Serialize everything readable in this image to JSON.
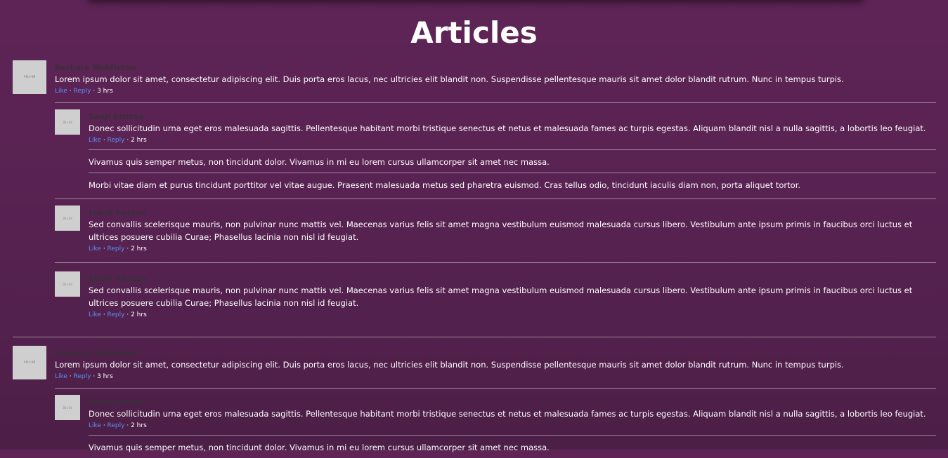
{
  "page": {
    "title": "Articles"
  },
  "threads": [
    {
      "author": "Barbara Middleton",
      "avatar_text": "48×48",
      "text": "Lorem ipsum dolor sit amet, consectetur adipiscing elit. Duis porta eros lacus, nec ultricies elit blandit non. Suspendisse pellentesque mauris sit amet dolor blandit rutrum. Nunc in tempus turpis.",
      "like": "Like",
      "reply": "Reply",
      "time": "3 hrs",
      "replies": [
        {
          "author": "Sonji Britton",
          "avatar_text": "36×36",
          "text": "Donec sollicitudin urna eget eros malesuada sagittis. Pellentesque habitant morbi tristique senectus et netus et malesuada fames ac turpis egestas. Aliquam blandit nisl a nulla sagittis, a lobortis leo feugiat.",
          "like": "Like",
          "reply": "Reply",
          "time": "2 hrs",
          "notes": [
            "Vivamus quis semper metus, non tincidunt dolor. Vivamus in mi eu lorem cursus ullamcorper sit amet nec massa.",
            "Morbi vitae diam et purus tincidunt porttitor vel vitae augue. Praesent malesuada metus sed pharetra euismod. Cras tellus odio, tincidunt iaculis diam non, porta aliquet tortor."
          ]
        },
        {
          "author": "Frank Keeton",
          "avatar_text": "36×36",
          "text": "Sed convallis scelerisque mauris, non pulvinar nunc mattis vel. Maecenas varius felis sit amet magna vestibulum euismod malesuada cursus libero. Vestibulum ante ipsum primis in faucibus orci luctus et ultrices posuere cubilia Curae; Phasellus lacinia non nisl id feugiat.",
          "like": "Like",
          "reply": "Reply",
          "time": "2 hrs"
        },
        {
          "author": "Frank Keeton",
          "avatar_text": "36×36",
          "text": "Sed convallis scelerisque mauris, non pulvinar nunc mattis vel. Maecenas varius felis sit amet magna vestibulum euismod malesuada cursus libero. Vestibulum ante ipsum primis in faucibus orci luctus et ultrices posuere cubilia Curae; Phasellus lacinia non nisl id feugiat.",
          "like": "Like",
          "reply": "Reply",
          "time": "2 hrs"
        }
      ]
    },
    {
      "author": "Barbara Middleton",
      "avatar_text": "48×48",
      "text": "Lorem ipsum dolor sit amet, consectetur adipiscing elit. Duis porta eros lacus, nec ultricies elit blandit non. Suspendisse pellentesque mauris sit amet dolor blandit rutrum. Nunc in tempus turpis.",
      "like": "Like",
      "reply": "Reply",
      "time": "3 hrs",
      "replies": [
        {
          "author": "Sonji Britton",
          "avatar_text": "36×36",
          "text": "Donec sollicitudin urna eget eros malesuada sagittis. Pellentesque habitant morbi tristique senectus et netus et malesuada fames ac turpis egestas. Aliquam blandit nisl a nulla sagittis, a lobortis leo feugiat.",
          "like": "Like",
          "reply": "Reply",
          "time": "2 hrs",
          "notes": [
            "Vivamus quis semper metus, non tincidunt dolor. Vivamus in mi eu lorem cursus ullamcorper sit amet nec massa."
          ]
        }
      ]
    }
  ]
}
